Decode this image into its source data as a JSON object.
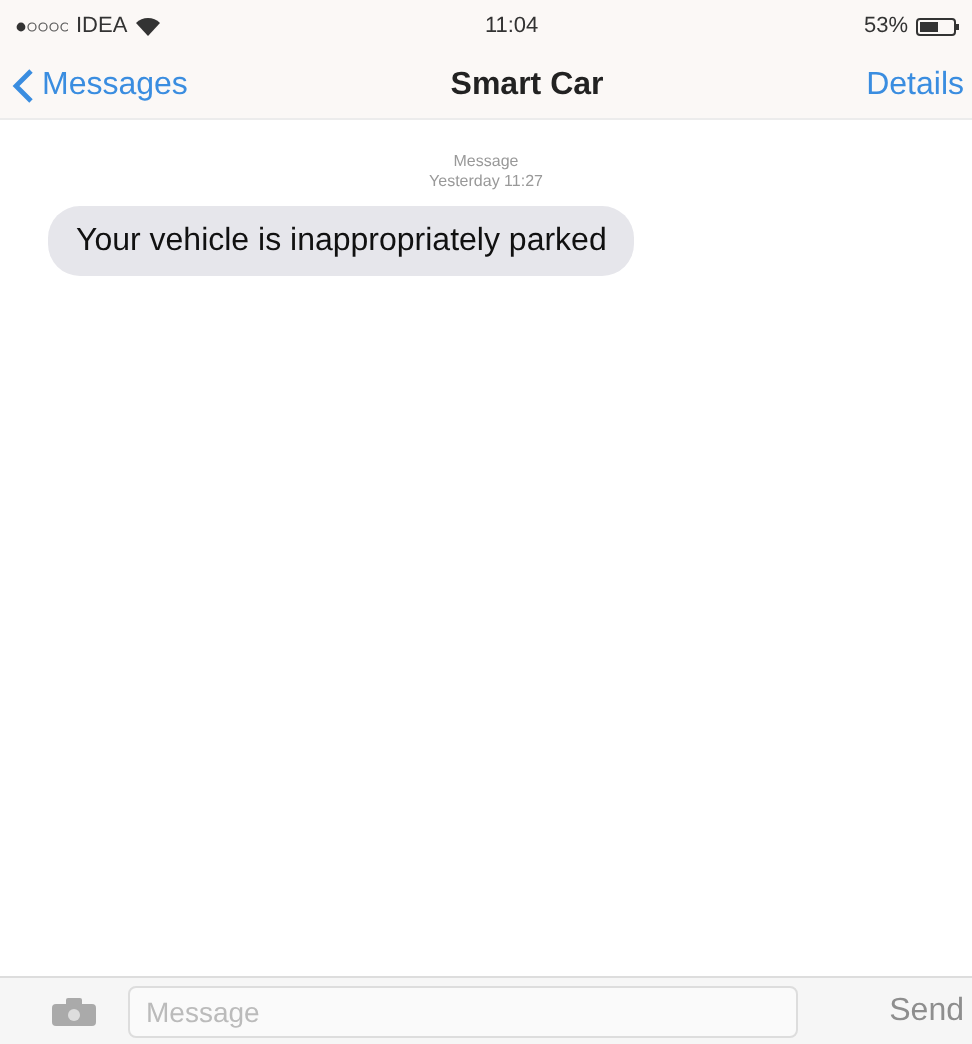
{
  "status_bar": {
    "carrier": "IDEA",
    "time": "11:04",
    "battery": "53%"
  },
  "nav_bar": {
    "back": "Messages",
    "title": "Smart Car",
    "action": "Details"
  },
  "thread": {
    "header": "Message",
    "timestamp": "Yesterday 11:27",
    "messages": [
      {
        "text": "Your vehicle is inappropriately parked",
        "kind": "incoming"
      }
    ]
  },
  "composer": {
    "placeholder": "Message",
    "send": "Send"
  }
}
